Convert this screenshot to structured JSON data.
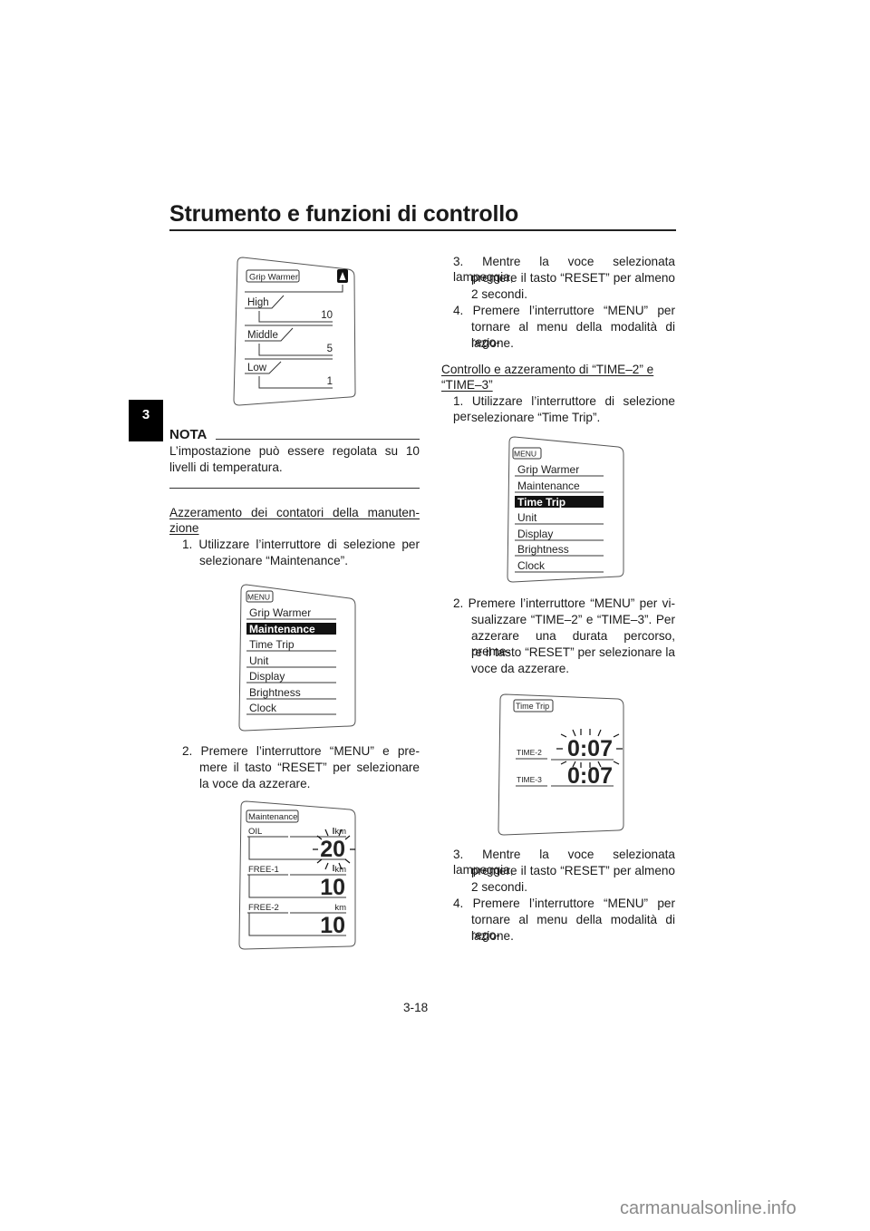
{
  "header": {
    "title": "Strumento e funzioni di controllo",
    "chapter": "3"
  },
  "left": {
    "nota_label": "NOTA",
    "nota_lines": [
      "L’impostazione può essere regolata su 10",
      "livelli di temperatura."
    ],
    "heading_lines": [
      "Azzeramento dei contatori della manuten-",
      "zione"
    ],
    "step1_lines": [
      "1. Utilizzare l’interruttore di selezione per",
      "selezionare “Maintenance”."
    ],
    "step2_lines": [
      "2. Premere l’interruttore “MENU” e pre-",
      "mere il tasto “RESET” per selezionare",
      "la voce da azzerare."
    ]
  },
  "right": {
    "step3_lines": [
      "3. Mentre la voce selezionata lampeggia,",
      "premere il tasto “RESET” per almeno",
      "2 secondi."
    ],
    "step4_lines": [
      "4. Premere l’interruttore “MENU” per",
      "tornare al menu della modalità di rego-",
      "lazione."
    ],
    "heading_lines": [
      "Controllo e azzeramento di “TIME–2” e",
      "“TIME–3”"
    ],
    "step1_lines": [
      "1. Utilizzare l’interruttore di selezione per",
      "selezionare “Time Trip”."
    ],
    "step2_lines": [
      "2. Premere l’interruttore “MENU” per vi-",
      "sualizzare “TIME–2” e “TIME–3”. Per",
      "azzerare una durata percorso, preme-",
      "re il tasto “RESET” per selezionare la",
      "voce da azzerare."
    ],
    "step3b_lines": [
      "3. Mentre la voce selezionata lampeggia,",
      "premere il tasto “RESET” per almeno",
      "2 secondi."
    ],
    "step4b_lines": [
      "4. Premere l’interruttore “MENU” per",
      "tornare al menu della modalità di rego-",
      "lazione."
    ]
  },
  "grip_diagram": {
    "title": "Grip Warmer",
    "levels": [
      {
        "label": "High",
        "value": "10"
      },
      {
        "label": "Middle",
        "value": "5"
      },
      {
        "label": "Low",
        "value": "1"
      }
    ]
  },
  "menu_diagram_1": {
    "title": "MENU",
    "items": [
      "Grip Warmer",
      "Maintenance",
      "Time Trip",
      "Unit",
      "Display",
      "Brightness",
      "Clock"
    ],
    "selected": "Maintenance"
  },
  "maint_diagram": {
    "title": "Maintenance",
    "rows": [
      {
        "label": "OIL",
        "unit": "km",
        "value": "20"
      },
      {
        "label": "FREE-1",
        "unit": "km",
        "value": "10"
      },
      {
        "label": "FREE-2",
        "unit": "km",
        "value": "10"
      }
    ]
  },
  "menu_diagram_2": {
    "title": "MENU",
    "items": [
      "Grip Warmer",
      "Maintenance",
      "Time Trip",
      "Unit",
      "Display",
      "Brightness",
      "Clock"
    ],
    "selected": "Time Trip"
  },
  "time_diagram": {
    "title": "Time Trip",
    "rows": [
      {
        "label": "TIME-2",
        "value": "0:07"
      },
      {
        "label": "TIME-3",
        "value": "0:07"
      }
    ]
  },
  "footer": {
    "page_number": "3-18",
    "watermark": "carmanualsonline.info"
  }
}
